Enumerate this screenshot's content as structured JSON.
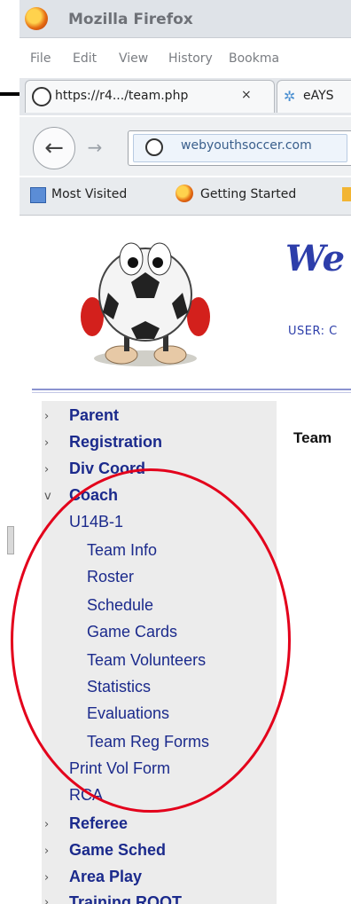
{
  "browser": {
    "app_title": "Mozilla Firefox",
    "menu": [
      "File",
      "Edit",
      "View",
      "History",
      "Bookma"
    ],
    "tabs": [
      {
        "label": "https://r4.../team.php",
        "close": "×"
      },
      {
        "label": "eAYS"
      }
    ],
    "url": "webyouthsoccer.com",
    "back_glyph": "←",
    "forward_glyph": "→",
    "bookmarks": [
      "Most Visited",
      "Getting Started"
    ]
  },
  "page": {
    "brand": "We",
    "user_label": "USER: C",
    "content_heading": "Team"
  },
  "sidebar": {
    "items": [
      {
        "label": "Parent",
        "arrow": "›"
      },
      {
        "label": "Registration",
        "arrow": "›"
      },
      {
        "label": "Div Coord",
        "arrow": "›"
      },
      {
        "label": "Coach",
        "arrow": "v"
      },
      {
        "label": "U14B-1"
      },
      {
        "label": "Team Info"
      },
      {
        "label": "Roster"
      },
      {
        "label": "Schedule"
      },
      {
        "label": "Game Cards"
      },
      {
        "label": "Team Volunteers"
      },
      {
        "label": "Statistics"
      },
      {
        "label": "Evaluations"
      },
      {
        "label": "Team Reg Forms"
      },
      {
        "label": "Print Vol Form"
      },
      {
        "label": "RCA"
      },
      {
        "label": "Referee",
        "arrow": "›"
      },
      {
        "label": "Game Sched",
        "arrow": "›"
      },
      {
        "label": "Area Play",
        "arrow": "›"
      },
      {
        "label": "Training ROOT",
        "arrow": "›"
      }
    ]
  },
  "colors": {
    "link": "#1b2a8c",
    "brand": "#2d3eaa",
    "annotation": "#e3001b",
    "sidebar_bg": "#ececec"
  }
}
